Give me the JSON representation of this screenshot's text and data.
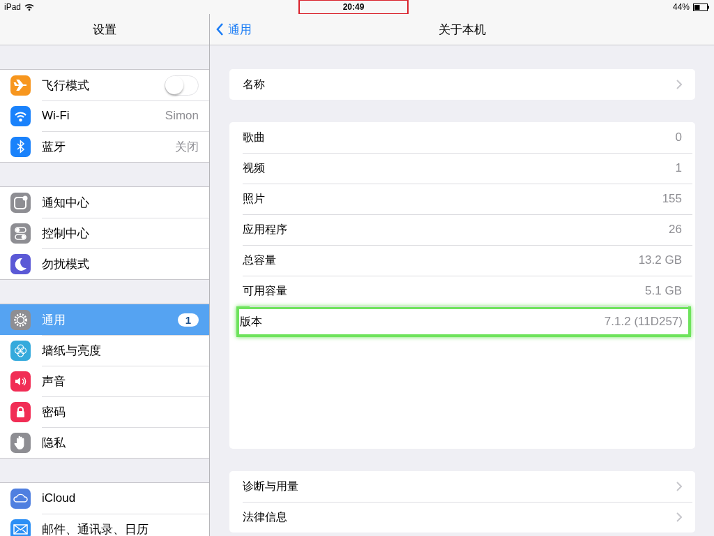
{
  "status_bar": {
    "device": "iPad",
    "time": "20:49",
    "time_highlighted": true,
    "battery": "44%"
  },
  "sidebar": {
    "title": "设置",
    "groups": [
      [
        {
          "label": "飞行模式",
          "kind": "toggle",
          "on": false,
          "selected": false
        },
        {
          "label": "Wi-Fi",
          "kind": "value",
          "value": "Simon",
          "selected": false
        },
        {
          "label": "蓝牙",
          "kind": "value",
          "value": "关闭",
          "selected": false
        }
      ],
      [
        {
          "label": "通知中心",
          "kind": "link",
          "selected": false
        },
        {
          "label": "控制中心",
          "kind": "link",
          "selected": false
        },
        {
          "label": "勿扰模式",
          "kind": "link",
          "selected": false
        }
      ],
      [
        {
          "label": "通用",
          "kind": "badge",
          "badge": "1",
          "selected": true
        },
        {
          "label": "墙纸与亮度",
          "kind": "link",
          "selected": false
        },
        {
          "label": "声音",
          "kind": "link",
          "selected": false
        },
        {
          "label": "密码",
          "kind": "link",
          "selected": false
        },
        {
          "label": "隐私",
          "kind": "link",
          "selected": false
        }
      ],
      [
        {
          "label": "iCloud",
          "kind": "link",
          "selected": false
        },
        {
          "label": "邮件、通讯录、日历",
          "kind": "link",
          "selected": false
        }
      ]
    ]
  },
  "detail": {
    "back": "通用",
    "title": "关于本机",
    "groups": [
      [
        {
          "label": "名称",
          "kind": "chevron",
          "highlighted": false
        }
      ],
      [
        {
          "label": "歌曲",
          "kind": "value",
          "value": "0",
          "highlighted": false
        },
        {
          "label": "视频",
          "kind": "value",
          "value": "1",
          "highlighted": false
        },
        {
          "label": "照片",
          "kind": "value",
          "value": "155",
          "highlighted": false
        },
        {
          "label": "应用程序",
          "kind": "value",
          "value": "26",
          "highlighted": false
        },
        {
          "label": "总容量",
          "kind": "value",
          "value": "13.2 GB",
          "highlighted": false
        },
        {
          "label": "可用容量",
          "kind": "value",
          "value": "5.1 GB",
          "highlighted": false
        },
        {
          "label": "版本",
          "kind": "value",
          "value": "7.1.2 (11D257)",
          "highlighted": true
        }
      ],
      [
        {
          "label": "诊断与用量",
          "kind": "chevron",
          "highlighted": false
        },
        {
          "label": "法律信息",
          "kind": "chevron",
          "highlighted": false
        }
      ]
    ]
  }
}
